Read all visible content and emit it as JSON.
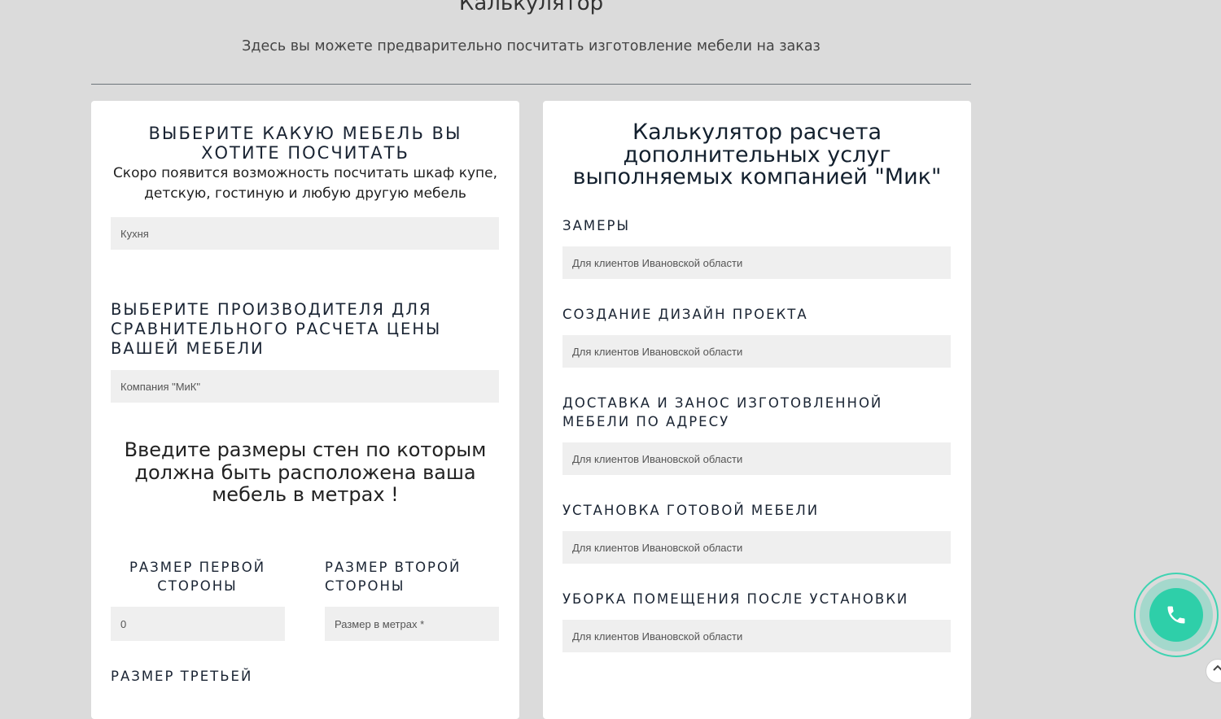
{
  "header": {
    "title": "Калькулятор",
    "subtitle": "Здесь вы можете предварительно посчитать изготовление мебели на заказ"
  },
  "left_card": {
    "furniture_heading": "Выберите какую мебель вы хотите посчитать",
    "furniture_description": "Скоро появится возможность посчитать шкаф купе, детскую, гостиную и любую другую мебель",
    "furniture_select_value": "Кухня",
    "manufacturer_heading": "Выберите производителя для сравнительного расчета цены вашей мебели",
    "manufacturer_select_value": "Компания \"МиК\"",
    "walls_heading": "Введите размеры стен по которым должна быть расположена ваша мебель в метрах !",
    "side1_label": "Размер первой стороны",
    "side1_value": "0",
    "side2_label": "Размер второй стороны",
    "side2_placeholder": "Размер в метрах *",
    "side3_label": "Размер третьей"
  },
  "right_card": {
    "title": "Калькулятор расчета дополнительных услуг выполняемых компанией \"Мик\"",
    "services": [
      {
        "label": "Замеры",
        "value": "Для клиентов Ивановской области"
      },
      {
        "label": "Создание дизайн проекта",
        "value": "Для клиентов Ивановской области"
      },
      {
        "label": "Доставка и занос изготовленной мебели по адресу",
        "value": "Для клиентов Ивановской области"
      },
      {
        "label": "Установка готовой мебели",
        "value": "Для клиентов Ивановской области"
      },
      {
        "label": "Уборка помещения после установки",
        "value": "Для клиентов Ивановской области"
      }
    ]
  },
  "icons": {
    "call": "phone-icon",
    "scroll_top": "chevron-up-icon"
  },
  "colors": {
    "accent": "#2ecfa9",
    "background": "#dbdbdb",
    "field": "#efefef"
  }
}
